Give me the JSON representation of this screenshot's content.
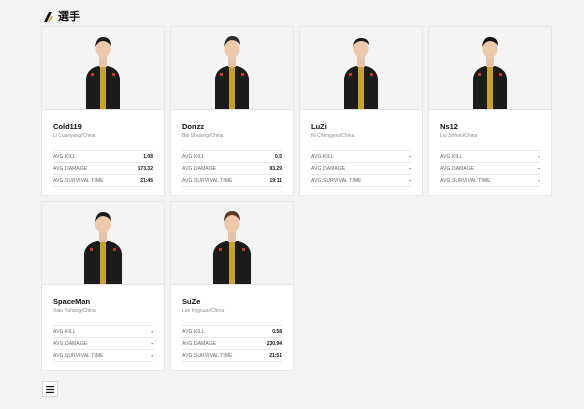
{
  "section": {
    "title": "選手",
    "icon": "slash-logo-icon",
    "accent": "#d4af37"
  },
  "stat_labels": {
    "kill": "AVG.KILL",
    "damage": "AVG.DAMAGE",
    "survival": "AVG.SURVIVAL TIME"
  },
  "players": [
    {
      "name": "Cold119",
      "real_name": "Li Cuanyang/China",
      "kill": "1.08",
      "damage": "173.32",
      "survival": "21:45"
    },
    {
      "name": "Donzz",
      "real_name": "Bai Shulong/China",
      "kill": "0.5",
      "damage": "93.29",
      "survival": "19:11"
    },
    {
      "name": "LuZi",
      "real_name": "Ni Chengyou/China",
      "kill": "-",
      "damage": "-",
      "survival": "-"
    },
    {
      "name": "Ns12",
      "real_name": "Liu Jinnan/China",
      "kill": "-",
      "damage": "-",
      "survival": "-"
    },
    {
      "name": "SpaceMan",
      "real_name": "Xiao Yuhang/China",
      "kill": "-",
      "damage": "-",
      "survival": "-"
    },
    {
      "name": "SuZe",
      "real_name": "Luo Ingyuan/China",
      "kill": "0.58",
      "damage": "230.94",
      "survival": "21:51"
    }
  ],
  "menu_button": {
    "icon": "hamburger-menu-icon"
  }
}
